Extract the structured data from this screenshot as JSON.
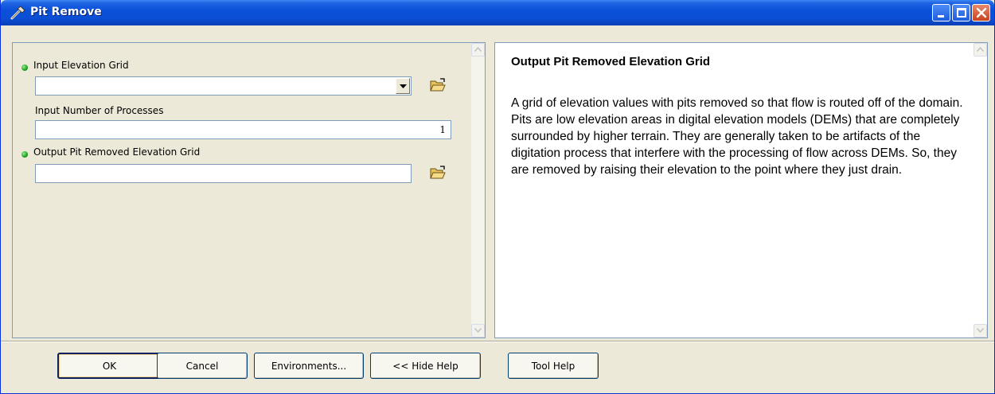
{
  "window": {
    "title": "Pit Remove"
  },
  "titlebar": {
    "icon": "hammer-icon",
    "controls": [
      "minimize-icon",
      "maximize-icon",
      "close-icon"
    ]
  },
  "form": {
    "input_elevation_grid": {
      "label": "Input Elevation Grid",
      "value": ""
    },
    "input_number_of_processes": {
      "label": "Input Number of Processes",
      "value": "1"
    },
    "output_pit_removed_grid": {
      "label": "Output Pit Removed Elevation Grid",
      "value": ""
    }
  },
  "help": {
    "title": "Output Pit Removed Elevation Grid",
    "body": "A grid of elevation values with pits removed so that flow is routed off of the domain. Pits are low elevation areas in digital elevation models (DEMs) that are completely surrounded by higher terrain. They are generally taken to be artifacts of the digitation process that interfere with the processing of flow across DEMs. So, they are removed by raising their elevation to the point where they just drain."
  },
  "buttons": {
    "ok": "OK",
    "cancel": "Cancel",
    "environments": "Environments...",
    "hide_help": "<< Hide Help",
    "tool_help": "Tool Help"
  },
  "colors": {
    "titlebar": "#0a50d8",
    "dialog_bg": "#ece9d8",
    "required_dot": "#1ea11e"
  }
}
